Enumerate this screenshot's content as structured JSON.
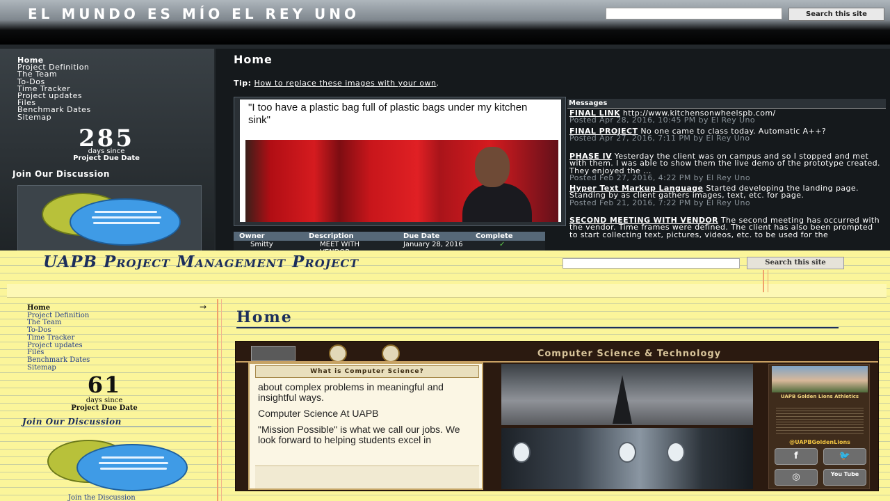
{
  "top": {
    "site_title": "El Mundo Es Mío El Rey Uno",
    "search": {
      "placeholder": "",
      "button": "Search this site"
    },
    "nav": [
      "Home",
      "Project Definition",
      "The Team",
      "To-Dos",
      "Time Tracker",
      "Project updates",
      "Files",
      "Benchmark Dates",
      "Sitemap"
    ],
    "counter": {
      "number": "285",
      "since": "days since",
      "label": "Project Due Date"
    },
    "join_heading": "Join Our Discussion",
    "page_title": "Home",
    "tip": {
      "label": "Tip:",
      "link": "How to replace these images with your own",
      "end": "."
    },
    "meme_text": "\"I too have a plastic bag full of plastic bags under my kitchen sink\"",
    "table": {
      "headers": [
        "Owner",
        "Description",
        "Due Date",
        "Complete"
      ],
      "row": {
        "owner": "Smitty",
        "description": "MEET WITH VENDOR",
        "due": "January 28, 2016",
        "complete": "✓"
      }
    },
    "messages": {
      "title": "Messages",
      "items": [
        {
          "title": "FINAL LINK",
          "body": "http://www.kitchensonwheelspb.com/",
          "posted": "Posted Apr 28, 2016, 10:45 PM by El Rey Uno"
        },
        {
          "title": "FINAL PROJECT",
          "body": "No one came to class today. Automatic A++?",
          "posted": "Posted Apr 27, 2016, 7:11 PM by El Rey Uno"
        },
        {
          "title": "PHASE IV",
          "body": "Yesterday the client was on campus and so I stopped and met with them. I was able to show them the live demo of the prototype created. They enjoyed the ...",
          "posted": "Posted Feb 27, 2016, 4:22 PM by El Rey Uno"
        },
        {
          "title": "Hyper Text Markup Language",
          "body": "Started developing the landing page. Standing by as client gathers images, text, etc. for page.",
          "posted": "Posted Feb 21, 2016, 7:22 PM by El Rey Uno"
        },
        {
          "title": "SECOND MEETING WITH VENDOR",
          "body": "The second meeting has occurred with the vendor. Time frames were defined. The client has also been prompted to start collecting text, pictures, videos, etc. to be used for the",
          "posted": ""
        }
      ]
    }
  },
  "bottom": {
    "site_title": "UAPB Project Management Project",
    "search": {
      "placeholder": "",
      "button": "Search this site"
    },
    "nav": [
      "Home",
      "Project Definition",
      "The Team",
      "To-Dos",
      "Time Tracker",
      "Project updates",
      "Files",
      "Benchmark Dates",
      "Sitemap"
    ],
    "counter": {
      "number": "61",
      "since": "days since",
      "label": "Project Due Date"
    },
    "join_heading": "Join Our Discussion",
    "join_link": "Join the Discussion",
    "page_title": "Home",
    "banner": {
      "heading": "Computer Science & Technology",
      "panel_tab": "What is Computer Science?",
      "panel_lines": [
        "about complex problems in meaningful and insightful ways.",
        "Computer Science At UAPB",
        "\"Mission Possible\" is what we call our jobs. We look forward to helping students excel in"
      ],
      "side_title": "UAPB Golden Lions Athletics",
      "side_handle": "@UAPBGoldenLions",
      "social": [
        "f",
        "🐦",
        "◎",
        "You Tube"
      ]
    }
  },
  "colors": {
    "top_bg": "#23282c",
    "bottom_bg": "#fbf59a",
    "bottom_title": "#1c2e5c",
    "link_blue": "#1f3a8a",
    "check_green": "#5ecc4a"
  }
}
